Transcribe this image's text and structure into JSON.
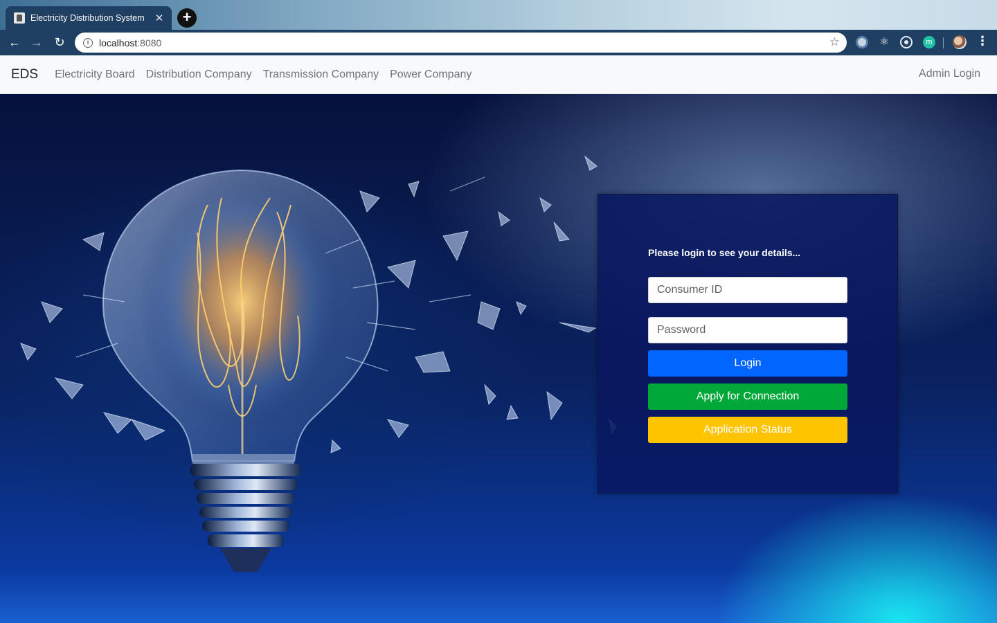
{
  "browser": {
    "tab_title": "Electricity Distribution System",
    "tab_close": "✕",
    "new_tab": "+",
    "url_host": "localhost",
    "url_port": ":8080",
    "extension_badge": "m"
  },
  "navbar": {
    "brand": "EDS",
    "links": [
      "Electricity Board",
      "Distribution Company",
      "Transmission Company",
      "Power Company"
    ],
    "right_link": "Admin Login"
  },
  "login_card": {
    "heading": "Please login to see your details...",
    "consumer_id_placeholder": "Consumer ID",
    "password_placeholder": "Password",
    "login_label": "Login",
    "apply_label": "Apply for Connection",
    "status_label": "Application Status"
  },
  "colors": {
    "login": "#0066ff",
    "apply": "#00a83a",
    "status": "#ffc400",
    "browser_frame": "#1f3f63"
  }
}
